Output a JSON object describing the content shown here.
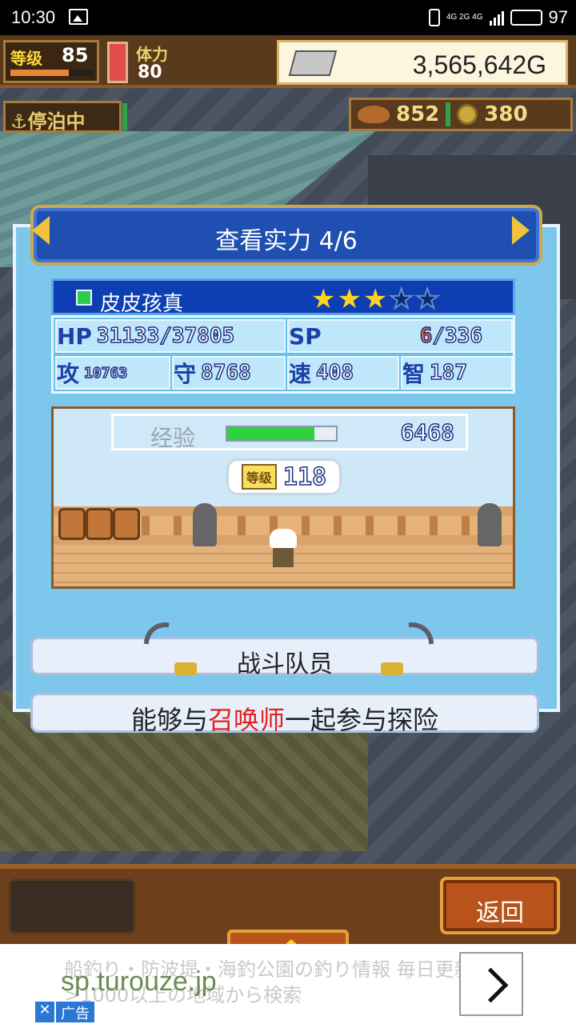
{
  "status_bar": {
    "time": "10:30",
    "network": "4G 2G 4G",
    "battery": "97"
  },
  "hud": {
    "level_label": "等级",
    "level": "85",
    "stamina_label": "体力",
    "stamina": "80",
    "gold": "3,565,642G",
    "location": "停泊中",
    "shells": "852",
    "coins": "380"
  },
  "dialog": {
    "title": "查看实力 4/6",
    "character": {
      "name": "皮皮孩真",
      "stars": 3,
      "max_stars": 5,
      "hp_label": "HP",
      "hp": "31133/37805",
      "sp_label": "SP",
      "sp_current": "6",
      "sp_max": "/336",
      "atk_label": "攻",
      "atk": "10763",
      "def_label": "守",
      "def": "8768",
      "spd_label": "速",
      "spd": "408",
      "int_label": "智",
      "int": "187",
      "exp_label": "经验",
      "exp_progress": 0.8,
      "exp": "6468",
      "level_label": "等级",
      "level": "118"
    },
    "role": "战斗队员",
    "description_pre": "能够与",
    "description_highlight": "召唤师",
    "description_post": "一起参与探险"
  },
  "bottom": {
    "back_label": "返回"
  },
  "ad": {
    "text": "船釣り・防波堤・海釣公園の釣り情報 毎日更新>1000以上の地域から検索",
    "url": "sp.turouze.jp",
    "tag": "广告",
    "close": "✕"
  }
}
